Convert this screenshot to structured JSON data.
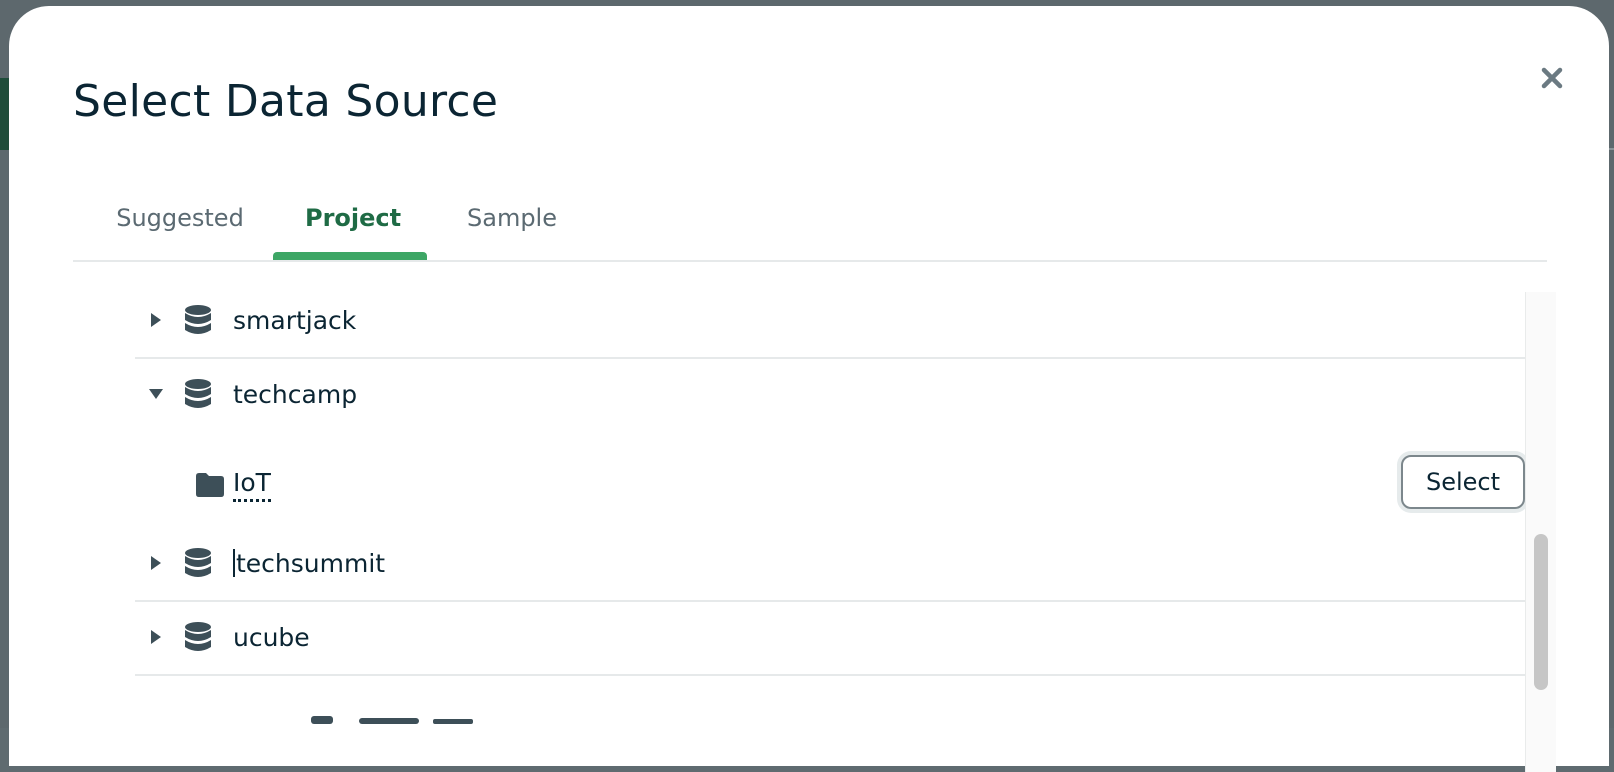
{
  "dialog": {
    "title": "Select Data Source",
    "close_icon": "close-icon"
  },
  "tabs": [
    {
      "label": "Suggested",
      "active": false
    },
    {
      "label": "Project",
      "active": true
    },
    {
      "label": "Sample",
      "active": false
    }
  ],
  "databases": [
    {
      "name": "smartjack",
      "expanded": false,
      "icon": "database-icon"
    },
    {
      "name": "techcamp",
      "expanded": true,
      "icon": "database-icon",
      "collections": [
        {
          "name": "IoT",
          "icon": "folder-icon",
          "action_label": "Select"
        }
      ]
    },
    {
      "name": "techsummit",
      "expanded": false,
      "icon": "database-icon"
    },
    {
      "name": "ucube",
      "expanded": false,
      "icon": "database-icon"
    }
  ],
  "colors": {
    "accent": "#3da665",
    "active_tab_text": "#1f6b45",
    "text_primary": "#0b2533",
    "text_muted": "#5b6a72"
  }
}
